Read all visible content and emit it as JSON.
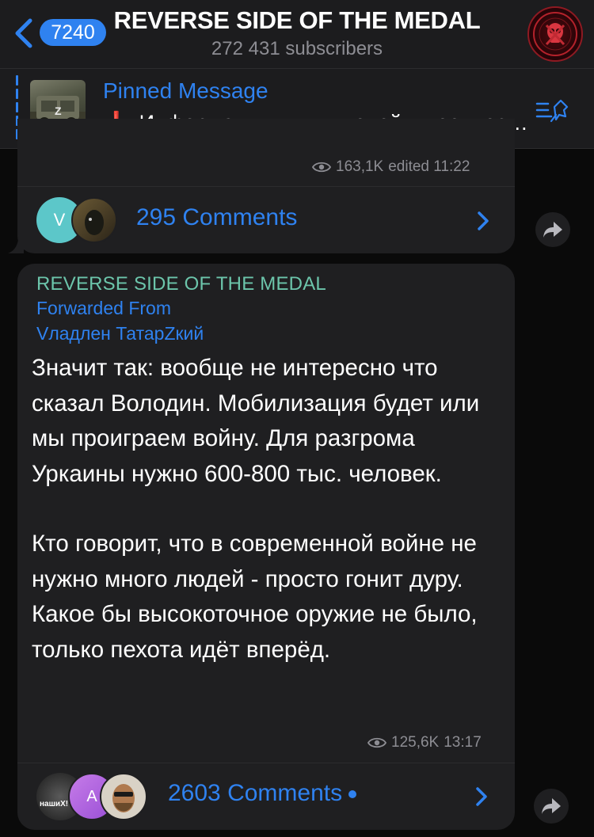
{
  "header": {
    "unread_count": "7240",
    "title": "REVERSE SIDE OF THE MEDAL",
    "subscribers": "272 431 subscribers"
  },
  "pinned": {
    "title": "Pinned Message",
    "text": "Информация для жителей и военнослужащих",
    "thumb_label": "Z"
  },
  "message1": {
    "views": "163,1K",
    "edited": "edited 11:22",
    "comments": "295 Comments",
    "avatar_letter": "V"
  },
  "message2": {
    "channel": "REVERSE SIDE OF THE MEDAL",
    "forwarded_label": "Forwarded From",
    "forwarded_name": "Vладлен ТатарZкий",
    "paragraphs": [
      "Значит так: вообще не интересно что сказал Володин. Мобилизация будет или мы проиграем войну. Для разгрома Уркаины нужно 600-800 тыс. человек.",
      "Кто говорит, что в современной войне не нужно много людей - просто гонит дуру. Какое бы высокоточное оружие не было, только пехота идёт вперёд."
    ],
    "views": "125,6K",
    "time": "13:17",
    "comments": "2603 Comments",
    "avatar_letter": "A",
    "avatar_z_label": "нашиХ!"
  },
  "colors": {
    "accent": "#2f82f0",
    "channel_name": "#6cc5ab",
    "bubble": "#1f1f21",
    "header": "#1c1c1e",
    "muted": "#8d8d93"
  }
}
